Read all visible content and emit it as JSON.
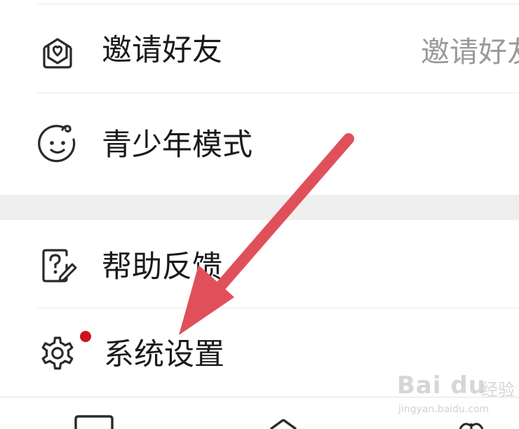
{
  "menu": {
    "items": [
      {
        "label": "邀请好友",
        "value": "邀请好友",
        "icon": "envelope-heart-icon"
      },
      {
        "label": "青少年模式",
        "icon": "baby-face-icon"
      },
      {
        "label": "帮助反馈",
        "icon": "help-feedback-icon"
      },
      {
        "label": "系统设置",
        "icon": "gear-icon",
        "has_notification_dot": true
      }
    ]
  },
  "annotation": {
    "arrow_color": "#e0505a"
  },
  "watermark": {
    "brand": "Bai du",
    "suffix": "经验",
    "url": "jingyan.baidu.com"
  },
  "colors": {
    "notification_dot": "#c9161e",
    "section_gap": "#efefef",
    "text": "#1a1a1a",
    "value_text": "#9a9a9a"
  }
}
